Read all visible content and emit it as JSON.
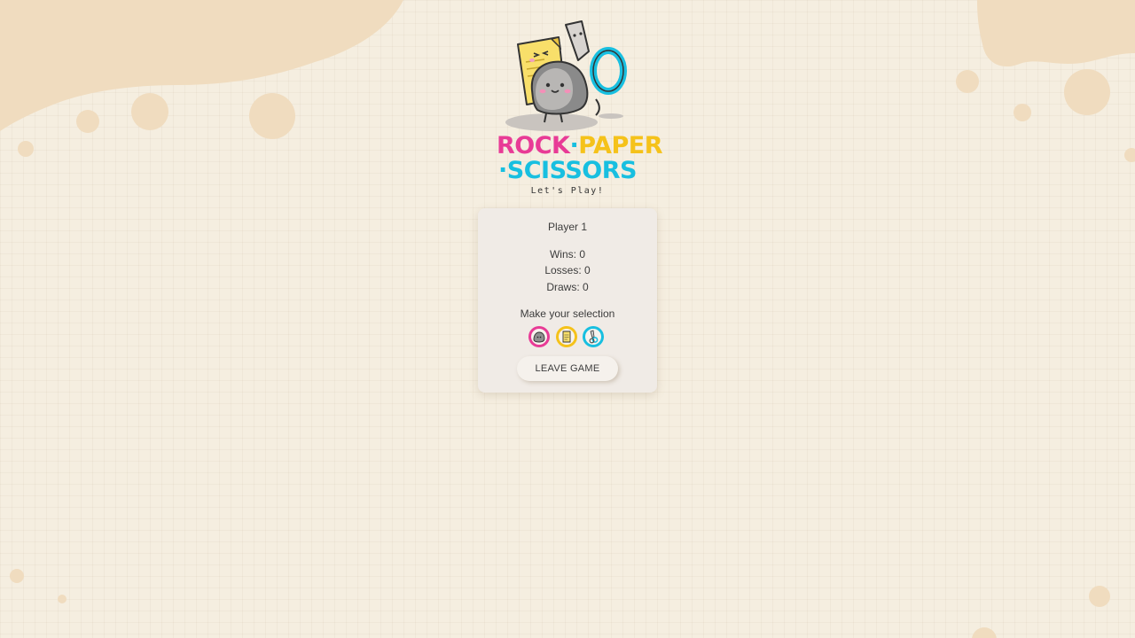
{
  "logo": {
    "word_rock": "ROCK",
    "dot1": "·",
    "word_paper": "PAPER",
    "word_scissors": "·SCISSORS",
    "tagline": "Let's Play!"
  },
  "player": {
    "name": "Player 1",
    "wins": "Wins: 0",
    "losses": "Losses: 0",
    "draws": "Draws: 0"
  },
  "selection": {
    "prompt": "Make your selection",
    "options": [
      "rock-icon",
      "paper-icon",
      "scissors-icon"
    ]
  },
  "actions": {
    "leave_label": "LEAVE GAME"
  },
  "colors": {
    "background": "#f5eee0",
    "card": "#f0ebe6",
    "rock": "#e83b96",
    "paper": "#f5c21a",
    "scissors": "#18bfe0"
  }
}
